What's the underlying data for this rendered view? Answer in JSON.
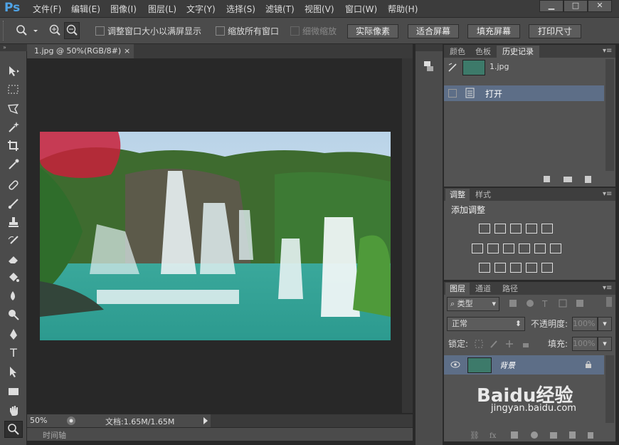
{
  "app": {
    "logo": "Ps"
  },
  "menubar": {
    "items": [
      "文件(F)",
      "编辑(E)",
      "图像(I)",
      "图层(L)",
      "文字(Y)",
      "选择(S)",
      "滤镜(T)",
      "视图(V)",
      "窗口(W)",
      "帮助(H)"
    ]
  },
  "window_controls": {
    "minimize": "▁",
    "maximize": "□",
    "close": "✕"
  },
  "options": {
    "checkboxes": [
      "调整窗口大小以满屏显示",
      "缩放所有窗口",
      "细微缩放"
    ],
    "buttons": [
      "实际像素",
      "适合屏幕",
      "填充屏幕",
      "打印尺寸"
    ]
  },
  "document": {
    "tab_title": "1.jpg @ 50%(RGB/8#)",
    "tab_close": "×",
    "zoom": "50%",
    "doc_info": "文档:1.65M/1.65M",
    "timeline_label": "时间轴"
  },
  "history_panel": {
    "tabs": [
      "颜色",
      "色板",
      "历史记录"
    ],
    "active_tab": 2,
    "snapshot": "1.jpg",
    "items": [
      "打开"
    ]
  },
  "adjust_panel": {
    "tabs": [
      "调整",
      "样式"
    ],
    "active_tab": 0,
    "title": "添加调整"
  },
  "layers_panel": {
    "tabs": [
      "图层",
      "通道",
      "路径"
    ],
    "active_tab": 0,
    "filter": "类型",
    "blend_mode": "正常",
    "opacity_label": "不透明度:",
    "opacity": "100%",
    "lock_label": "锁定:",
    "fill_label": "填充:",
    "fill": "100%",
    "layers": [
      {
        "name": "背景"
      }
    ]
  },
  "watermark": {
    "brand": "Baidu经验",
    "url": "jingyan.baidu.com"
  },
  "colors": {
    "accent": "#4fa3e6",
    "selected_row": "#5d6e87",
    "panel_bg": "#535353"
  }
}
